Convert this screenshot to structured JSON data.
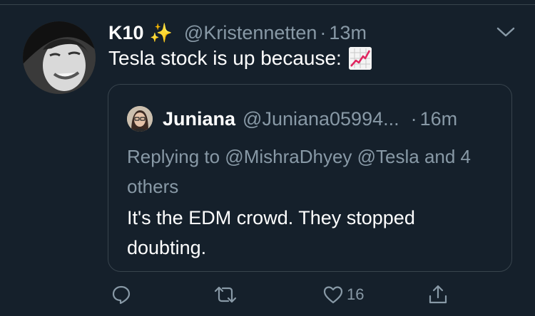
{
  "tweet": {
    "display_name": "K10",
    "emoji": "✨",
    "handle": "@Kristennetten",
    "separator": "·",
    "time": "13m",
    "text": "Tesla stock is up because:",
    "text_emoji": "chart-increasing-emoji",
    "avatar": "user-avatar-photo"
  },
  "quoted": {
    "display_name": "Juniana",
    "handle": "@Juniana05994...",
    "separator": "·",
    "time": "16m",
    "replying_to": "Replying to @MishraDhyey @Tesla and 4 others",
    "text": "It's the EDM crowd.  They stopped doubting."
  },
  "actions": {
    "reply_icon": "reply-icon",
    "retweet_icon": "retweet-icon",
    "like_icon": "heart-icon",
    "like_count": "16",
    "share_icon": "share-icon"
  },
  "colors": {
    "background": "#15202b",
    "muted": "#8899a6",
    "border": "#38444d",
    "sparkle": "#f5c842",
    "chart_line": "#e0245e"
  }
}
